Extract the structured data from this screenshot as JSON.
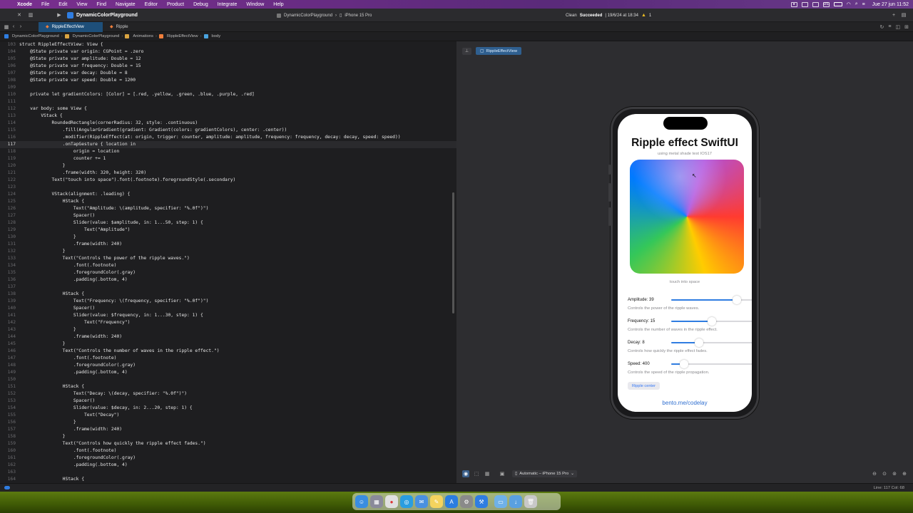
{
  "menubar": {
    "items": [
      "Xcode",
      "File",
      "Edit",
      "View",
      "Find",
      "Navigate",
      "Editor",
      "Product",
      "Debug",
      "Integrate",
      "Window",
      "Help"
    ],
    "clock": "Jue 27 jun 11:52",
    "lang": "US"
  },
  "toolbar": {
    "project": "DynamicColorPlayground",
    "scheme": "DynamicColorPlayground",
    "destination": "iPhone 15 Pro",
    "status_prefix": "Clean",
    "status_strong": "Succeeded",
    "status_date": "| 19/6/24 at 18:34",
    "warning_count": "1"
  },
  "tabs": [
    {
      "label": "RippleEffectView",
      "active": true
    },
    {
      "label": "Ripple",
      "active": false
    }
  ],
  "breadcrumb": [
    "DynamicColorPlayground",
    "DynamicColorPlayground",
    "Animations",
    "RippleEffectView",
    "body"
  ],
  "editor": {
    "current_line": 117,
    "lines": [
      {
        "n": "103",
        "t": "struct RippleEffectView: View {"
      },
      {
        "n": "104",
        "t": "    @State private var origin: CGPoint = .zero"
      },
      {
        "n": "105",
        "t": "    @State private var amplitude: Double = 12"
      },
      {
        "n": "106",
        "t": "    @State private var frequency: Double = 15"
      },
      {
        "n": "107",
        "t": "    @State private var decay: Double = 8"
      },
      {
        "n": "108",
        "t": "    @State private var speed: Double = 1200"
      },
      {
        "n": "109",
        "t": ""
      },
      {
        "n": "110",
        "t": "    private let gradientColors: [Color] = [.red, .yellow, .green, .blue, .purple, .red]"
      },
      {
        "n": "111",
        "t": ""
      },
      {
        "n": "112",
        "t": "    var body: some View {"
      },
      {
        "n": "113",
        "t": "        VStack {"
      },
      {
        "n": "114",
        "t": "            RoundedRectangle(cornerRadius: 32, style: .continuous)"
      },
      {
        "n": "115",
        "t": "                .fill(AngularGradient(gradient: Gradient(colors: gradientColors), center: .center))"
      },
      {
        "n": "116",
        "t": "                .modifier(RippleEffect(at: origin, trigger: counter, amplitude: amplitude, frequency: frequency, decay: decay, speed: speed))"
      },
      {
        "n": "117",
        "t": "                .onTapGesture { location in"
      },
      {
        "n": "118",
        "t": "                    origin = location"
      },
      {
        "n": "119",
        "t": "                    counter += 1"
      },
      {
        "n": "120",
        "t": "                }"
      },
      {
        "n": "121",
        "t": "                .frame(width: 320, height: 320)"
      },
      {
        "n": "122",
        "t": "            Text(\"touch into space\").font(.footnote).foregroundStyle(.secondary)"
      },
      {
        "n": "123",
        "t": ""
      },
      {
        "n": "124",
        "t": "            VStack(alignment: .leading) {"
      },
      {
        "n": "125",
        "t": "                HStack {"
      },
      {
        "n": "126",
        "t": "                    Text(\"Amplitude: \\(amplitude, specifier: \"%.0f\")\")"
      },
      {
        "n": "127",
        "t": "                    Spacer()"
      },
      {
        "n": "128",
        "t": "                    Slider(value: $amplitude, in: 1...50, step: 1) {"
      },
      {
        "n": "129",
        "t": "                        Text(\"Amplitude\")"
      },
      {
        "n": "130",
        "t": "                    }"
      },
      {
        "n": "131",
        "t": "                    .frame(width: 240)"
      },
      {
        "n": "132",
        "t": "                }"
      },
      {
        "n": "133",
        "t": "                Text(\"Controls the power of the ripple waves.\")"
      },
      {
        "n": "134",
        "t": "                    .font(.footnote)"
      },
      {
        "n": "135",
        "t": "                    .foregroundColor(.gray)"
      },
      {
        "n": "136",
        "t": "                    .padding(.bottom, 4)"
      },
      {
        "n": "137",
        "t": ""
      },
      {
        "n": "138",
        "t": "                HStack {"
      },
      {
        "n": "139",
        "t": "                    Text(\"Frequency: \\(frequency, specifier: \"%.0f\")\")"
      },
      {
        "n": "140",
        "t": "                    Spacer()"
      },
      {
        "n": "141",
        "t": "                    Slider(value: $frequency, in: 1...30, step: 1) {"
      },
      {
        "n": "142",
        "t": "                        Text(\"Frequency\")"
      },
      {
        "n": "143",
        "t": "                    }"
      },
      {
        "n": "144",
        "t": "                    .frame(width: 240)"
      },
      {
        "n": "145",
        "t": "                }"
      },
      {
        "n": "146",
        "t": "                Text(\"Controls the number of waves in the ripple effect.\")"
      },
      {
        "n": "147",
        "t": "                    .font(.footnote)"
      },
      {
        "n": "148",
        "t": "                    .foregroundColor(.gray)"
      },
      {
        "n": "149",
        "t": "                    .padding(.bottom, 4)"
      },
      {
        "n": "150",
        "t": ""
      },
      {
        "n": "151",
        "t": "                HStack {"
      },
      {
        "n": "152",
        "t": "                    Text(\"Decay: \\(decay, specifier: \"%.0f\")\")"
      },
      {
        "n": "153",
        "t": "                    Spacer()"
      },
      {
        "n": "154",
        "t": "                    Slider(value: $decay, in: 2...20, step: 1) {"
      },
      {
        "n": "155",
        "t": "                        Text(\"Decay\")"
      },
      {
        "n": "156",
        "t": "                    }"
      },
      {
        "n": "157",
        "t": "                    .frame(width: 240)"
      },
      {
        "n": "158",
        "t": "                }"
      },
      {
        "n": "159",
        "t": "                Text(\"Controls how quickly the ripple effect fades.\")"
      },
      {
        "n": "160",
        "t": "                    .font(.footnote)"
      },
      {
        "n": "161",
        "t": "                    .foregroundColor(.gray)"
      },
      {
        "n": "162",
        "t": "                    .padding(.bottom, 4)"
      },
      {
        "n": "163",
        "t": ""
      },
      {
        "n": "164",
        "t": "                HStack {"
      }
    ]
  },
  "canvas": {
    "preview_chip": "RippleEffectView",
    "device_picker": "Automatic – iPhone 15 Pro"
  },
  "app": {
    "title": "Ripple effect SwiftUI",
    "subtitle": "using metal shade test IOS17",
    "touch_label": "touch into space",
    "controls": [
      {
        "label": "Amplitude: 39",
        "fraction": 0.78,
        "desc": "Controls the power of the ripple waves."
      },
      {
        "label": "Frequency: 15",
        "fraction": 0.48,
        "desc": "Controls the number of waves in the ripple effect."
      },
      {
        "label": "Decay: 8",
        "fraction": 0.33,
        "desc": "Controls how quickly the ripple effect fades."
      },
      {
        "label": "Speed: 400",
        "fraction": 0.15,
        "desc": "Controls the speed of the ripple propagation."
      }
    ],
    "ripple_button": "Ripple center",
    "footer_link": "bento.me/codelay"
  },
  "statusbar": {
    "position": "Line: 117  Col: 68"
  },
  "dock": {
    "apps": [
      "finder-icon",
      "launchpad-icon",
      "chrome-icon",
      "safari-icon",
      "mail-icon",
      "notes-icon",
      "appstore-icon",
      "settings-icon",
      "xcode-icon",
      "folder-icon",
      "downloads-icon",
      "trash-icon"
    ]
  }
}
